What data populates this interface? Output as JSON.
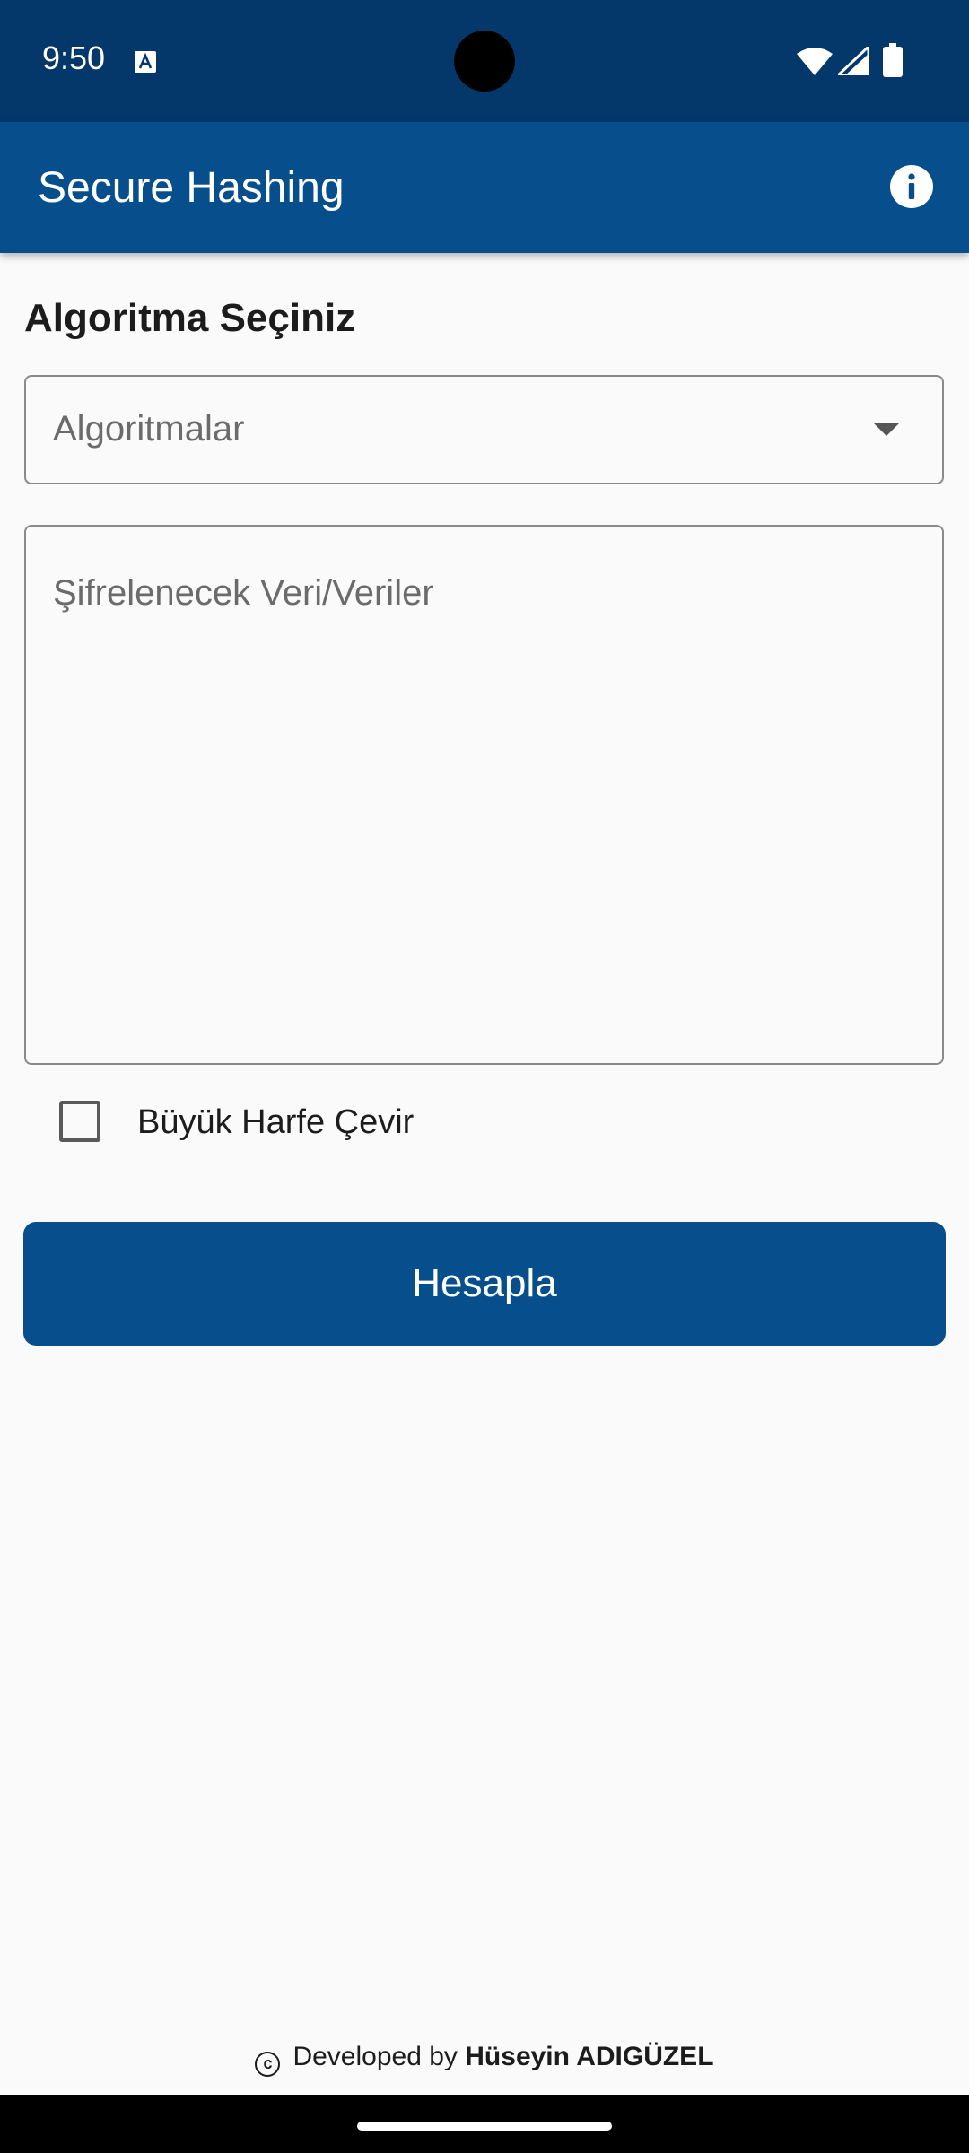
{
  "status_bar": {
    "time": "9:50",
    "icons": [
      "text-a-icon",
      "wifi-icon",
      "signal-icon",
      "battery-icon"
    ]
  },
  "app_bar": {
    "title": "Secure Hashing",
    "info_icon": "info-icon"
  },
  "form": {
    "section_title": "Algoritma Seçiniz",
    "algorithm_select": {
      "placeholder": "Algoritmalar",
      "value": ""
    },
    "data_input": {
      "placeholder": "Şifrelenecek Veri/Veriler",
      "value": ""
    },
    "uppercase_checkbox": {
      "label": "Büyük Harfe Çevir",
      "checked": false
    },
    "submit_label": "Hesapla"
  },
  "footer": {
    "prefix": "Developed by",
    "author": "Hüseyin ADIGÜZEL",
    "icon": "copyright-icon"
  },
  "colors": {
    "status_bar": "#04386a",
    "primary": "#064f8c",
    "background": "#fafafa"
  }
}
